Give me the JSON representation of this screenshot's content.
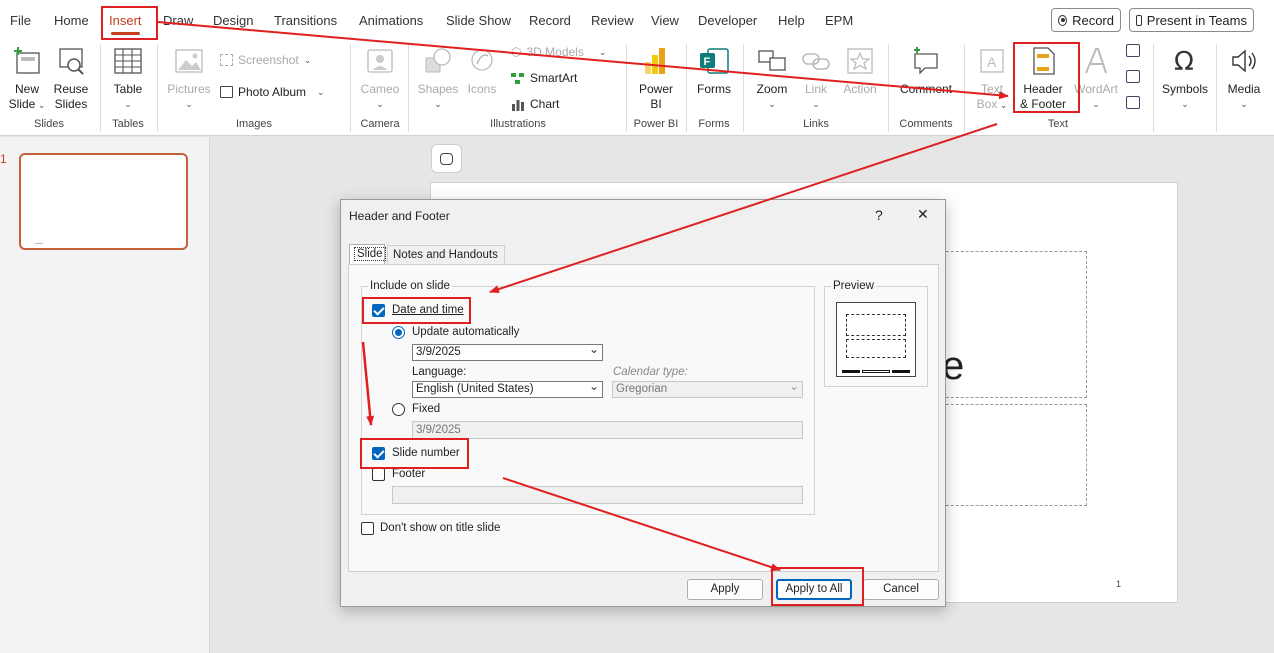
{
  "menu": {
    "tabs": [
      "File",
      "Home",
      "Insert",
      "Draw",
      "Design",
      "Transitions",
      "Animations",
      "Slide Show",
      "Record",
      "Review",
      "View",
      "Developer",
      "Help",
      "EPM"
    ],
    "active_tab": "Insert",
    "record_label": "Record",
    "present_label": "Present in Teams"
  },
  "ribbon": {
    "slides": {
      "new_slide": "New",
      "new_slide2": "Slide",
      "reuse": "Reuse",
      "reuse2": "Slides",
      "group": "Slides"
    },
    "tables": {
      "table": "Table",
      "group": "Tables"
    },
    "images": {
      "pictures": "Pictures",
      "screenshot": "Screenshot",
      "photo_album": "Photo Album",
      "group": "Images"
    },
    "camera": {
      "cameo": "Cameo",
      "group": "Camera"
    },
    "illustrations": {
      "shapes": "Shapes",
      "icons": "Icons",
      "models": "3D Models",
      "smartart": "SmartArt",
      "chart": "Chart",
      "group": "Illustrations"
    },
    "powerbi": {
      "label": "Power",
      "label2": "BI",
      "group": "Power BI"
    },
    "forms": {
      "label": "Forms",
      "group": "Forms"
    },
    "links": {
      "zoom": "Zoom",
      "link": "Link",
      "action": "Action",
      "group": "Links"
    },
    "comments": {
      "comment": "Comment",
      "group": "Comments"
    },
    "text": {
      "textbox": "Text",
      "textbox2": "Box",
      "header": "Header",
      "header2": "& Footer",
      "wordart": "WordArt",
      "group": "Text"
    },
    "symbols": {
      "label": "Symbols"
    },
    "media": {
      "label": "Media"
    }
  },
  "thumbnail": {
    "number": "1"
  },
  "slide": {
    "title_fragment": "e",
    "page_number": "1"
  },
  "dialog": {
    "title": "Header and Footer",
    "help": "?",
    "close": "✕",
    "tab_slide": "Slide",
    "tab_notes": "Notes and Handouts",
    "include_label": "Include on slide",
    "date_time": "Date and time",
    "update_auto": "Update automatically",
    "date_value": "3/9/2025",
    "language_label": "Language:",
    "language_value": "English (United States)",
    "calendar_label": "Calendar type:",
    "calendar_value": "Gregorian",
    "fixed": "Fixed",
    "fixed_value": "3/9/2025",
    "slide_number": "Slide number",
    "footer": "Footer",
    "dont_show": "Don't show on title slide",
    "preview": "Preview",
    "apply": "Apply",
    "apply_all": "Apply to All",
    "cancel": "Cancel"
  },
  "colors": {
    "accent": "#c43e1c",
    "annotation": "#e02020",
    "check": "#0067c0"
  }
}
